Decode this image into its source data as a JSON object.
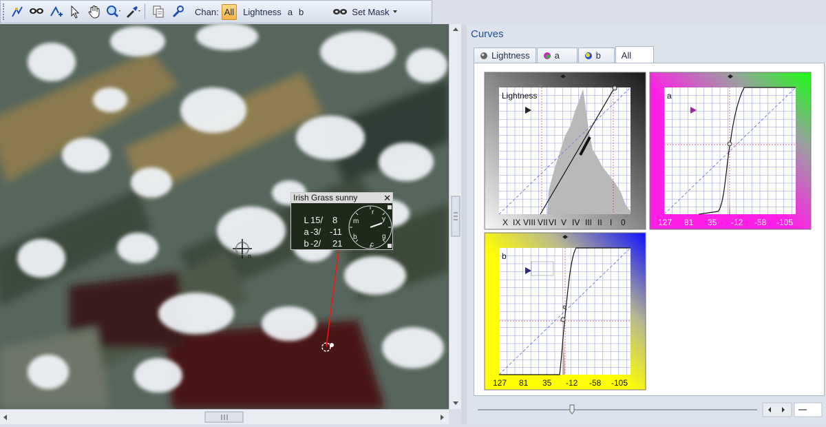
{
  "toolbar": {
    "icons": [
      "pen-curve-icon",
      "mask-icon",
      "add-point-icon",
      "arrow-select-icon",
      "hand-pan-icon",
      "zoom-icon",
      "eyedropper-icon",
      "copy-icon",
      "wrench-icon"
    ],
    "chan_label": "Chan:",
    "channels": [
      "All",
      "Lightness",
      "a",
      "b"
    ],
    "active_channel": "All",
    "set_mask_label": "Set Mask"
  },
  "readout": {
    "title": "Irish Grass  sunny",
    "rows": [
      {
        "name": "L",
        "v1": "15/",
        "v2": "8"
      },
      {
        "name": "a",
        "v1": "-3/",
        "v2": "-11"
      },
      {
        "name": "b",
        "v1": "-2/",
        "v2": "21"
      }
    ],
    "dial_letters": [
      "r",
      "y",
      "g",
      "c",
      "b",
      "m"
    ]
  },
  "curves_panel": {
    "title": "Curves",
    "tabs": [
      "Lightness",
      "a",
      "b",
      "All"
    ],
    "active_tab": "All",
    "lightness": {
      "label": "Lightness",
      "ticks": [
        "X",
        "IX",
        "VIII",
        "VII",
        "VI",
        "V",
        "IV",
        "III",
        "II",
        "I",
        "0"
      ]
    },
    "a": {
      "label": "a",
      "ticks": [
        "127",
        "81",
        "35",
        "-12",
        "-58",
        "-105"
      ]
    },
    "b": {
      "label": "b",
      "ticks": [
        "127",
        "81",
        "35",
        "-12",
        "-58",
        "-105"
      ]
    }
  },
  "colors": {
    "accent": "#f3b44a",
    "title_blue": "#1f4f8f",
    "curve_grid": "#6d74d9",
    "a_magenta": "#ff1fe6",
    "a_green": "#18ff10",
    "b_yellow": "#ffff00",
    "b_blue": "#1010ff"
  }
}
